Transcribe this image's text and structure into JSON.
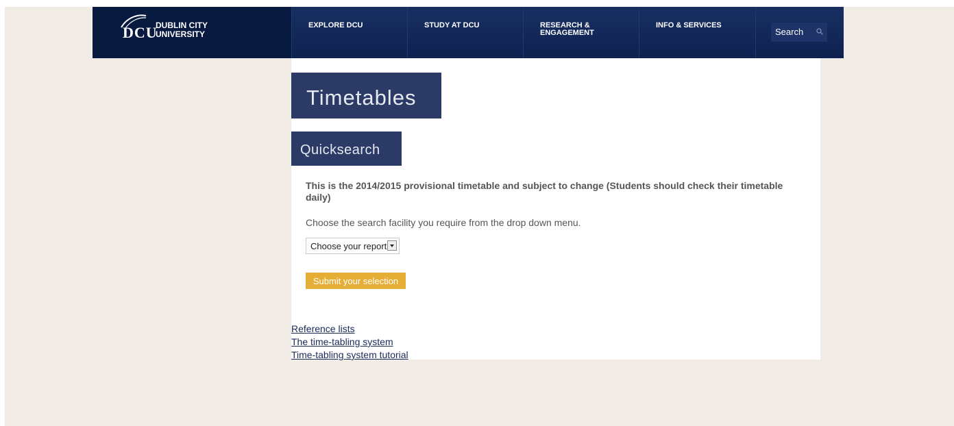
{
  "header": {
    "logo": {
      "mark": "DCU",
      "line1": "DUBLIN CITY",
      "line2": "UNIVERSITY"
    },
    "nav": [
      {
        "label": "EXPLORE DCU"
      },
      {
        "label": "STUDY AT DCU"
      },
      {
        "label": "RESEARCH & ENGAGEMENT"
      },
      {
        "label": "INFO & SERVICES"
      }
    ],
    "search": {
      "label": "Search",
      "icon": "search-icon"
    }
  },
  "main": {
    "title": "Timetables",
    "subtitle": "Quicksearch",
    "notice": "This is the 2014/2015 provisional timetable and subject to change (Students should check their timetable daily)",
    "instruction": "Choose the search facility you require from the drop down menu.",
    "report_select": {
      "selected": "Choose your report"
    },
    "submit_label": "Submit your selection",
    "links": [
      {
        "label": "Reference lists"
      },
      {
        "label": "The time-tabling system"
      },
      {
        "label": "Time-tabling system tutorial"
      }
    ]
  },
  "colors": {
    "navy": "#0b1f4a",
    "title_bg": "#2b3b65",
    "submit_bg": "#e5ae36",
    "page_bg": "#f0ebe4"
  }
}
